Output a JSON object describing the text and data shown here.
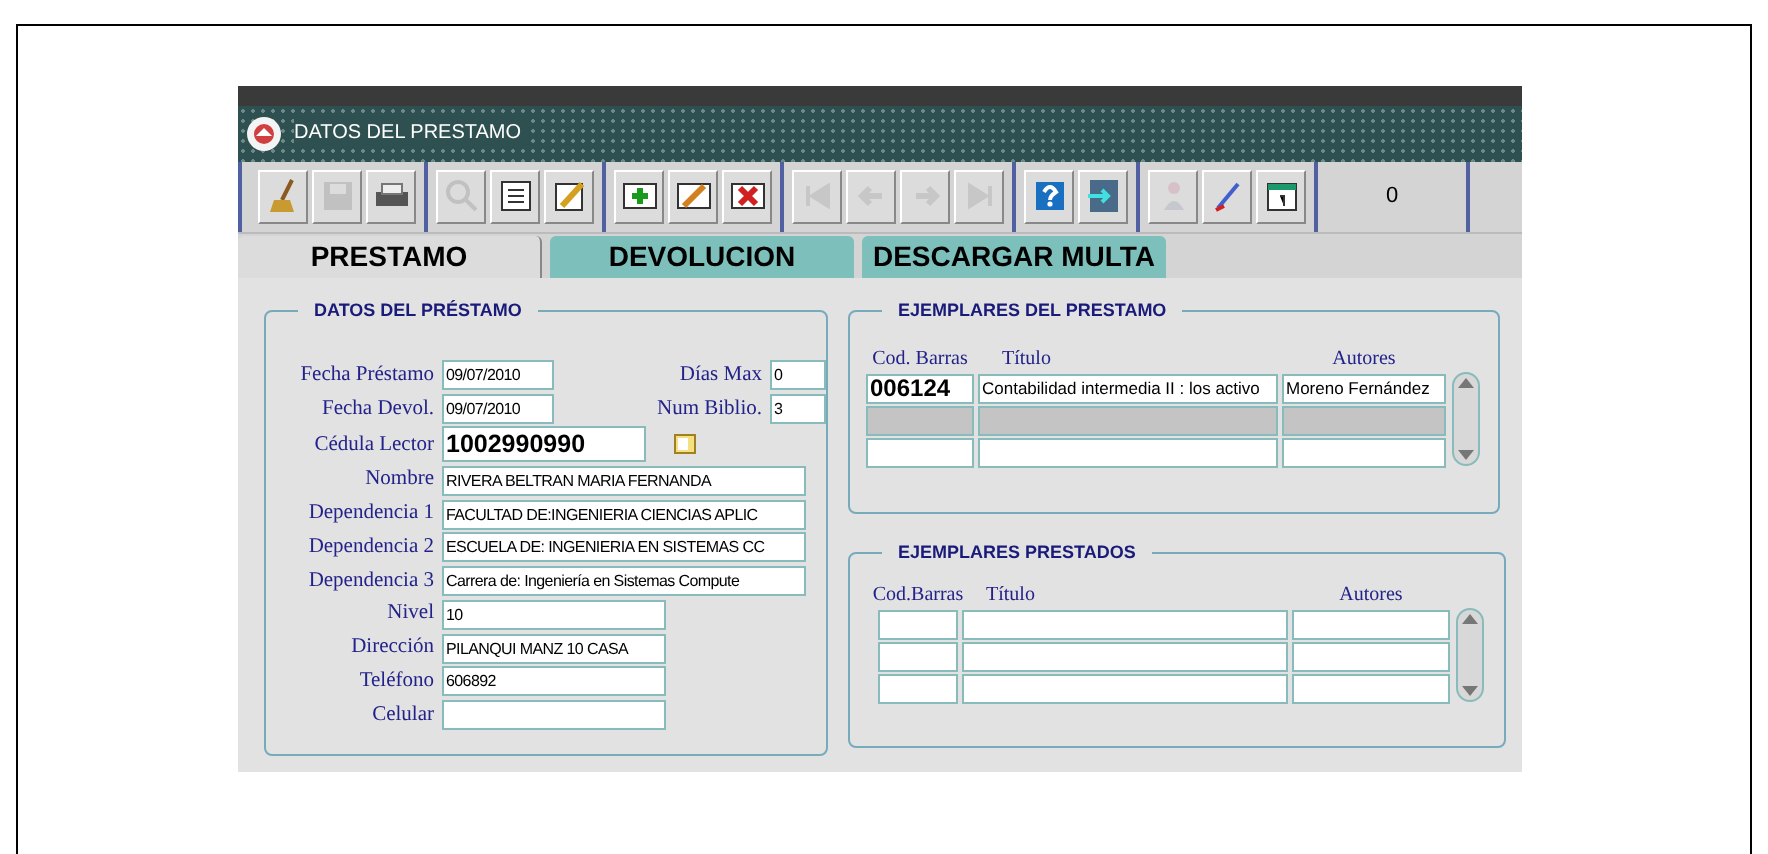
{
  "window": {
    "title": "DATOS DEL PRESTAMO"
  },
  "toolbar": {
    "groups": [
      {
        "buttons": [
          {
            "kind": "broom",
            "disabled": false
          },
          {
            "kind": "save",
            "disabled": true
          },
          {
            "kind": "printer",
            "disabled": false
          }
        ]
      },
      {
        "buttons": [
          {
            "kind": "search",
            "disabled": true
          },
          {
            "kind": "list",
            "disabled": false
          },
          {
            "kind": "pencil",
            "disabled": false
          }
        ]
      },
      {
        "buttons": [
          {
            "kind": "add",
            "disabled": false
          },
          {
            "kind": "edit",
            "disabled": false
          },
          {
            "kind": "delete",
            "disabled": false
          }
        ]
      },
      {
        "buttons": [
          {
            "kind": "first",
            "disabled": true
          },
          {
            "kind": "prev",
            "disabled": true
          },
          {
            "kind": "next",
            "disabled": true
          },
          {
            "kind": "last",
            "disabled": true
          }
        ]
      },
      {
        "buttons": [
          {
            "kind": "help",
            "disabled": false
          },
          {
            "kind": "exit",
            "disabled": false
          }
        ]
      },
      {
        "buttons": [
          {
            "kind": "person",
            "disabled": true
          },
          {
            "kind": "pen",
            "disabled": false
          },
          {
            "kind": "calendar",
            "disabled": false
          }
        ]
      }
    ],
    "counter": "0"
  },
  "tabs": [
    {
      "label": "PRESTAMO",
      "selected": true
    },
    {
      "label": "DEVOLUCION",
      "selected": false
    },
    {
      "label": "DESCARGAR MULTA",
      "selected": false
    }
  ],
  "loan_panel": {
    "title": "DATOS DEL PRÉSTAMO",
    "rows": [
      [
        {
          "label": "Fecha Préstamo",
          "value": "09/07/2010",
          "kind": "date"
        },
        {
          "label": "Días Max",
          "value": "0",
          "kind": "tiny"
        }
      ],
      [
        {
          "label": "Fecha Devol.",
          "value": "09/07/2010",
          "kind": "date"
        },
        {
          "label": "Num Biblio.",
          "value": "3",
          "kind": "tiny"
        }
      ],
      [
        {
          "label": "Cédula Lector",
          "value": "1002990990",
          "kind": "id"
        }
      ],
      [
        {
          "label": "Nombre",
          "value": "RIVERA BELTRAN MARIA FERNANDA",
          "kind": "long"
        }
      ],
      [
        {
          "label": "Dependencia 1",
          "value": "FACULTAD DE:INGENIERIA CIENCIAS APLIC",
          "kind": "long"
        }
      ],
      [
        {
          "label": "Dependencia 2",
          "value": "ESCUELA DE: INGENIERIA EN SISTEMAS CC",
          "kind": "long"
        }
      ],
      [
        {
          "label": "Dependencia 3",
          "value": "Carrera de: Ingeniería en Sistemas Compute",
          "kind": "long"
        }
      ],
      [
        {
          "label": "Nivel",
          "value": "10",
          "kind": "medium"
        }
      ],
      [
        {
          "label": "Dirección",
          "value": "PILANQUI MANZ 10 CASA",
          "kind": "medium"
        }
      ],
      [
        {
          "label": "Teléfono",
          "value": "606892",
          "kind": "medium"
        }
      ],
      [
        {
          "label": "Celular",
          "kind": "medium"
        }
      ]
    ]
  },
  "copies_panel": {
    "title": "EJEMPLARES DEL PRESTAMO",
    "columns": [
      "Cod. Barras",
      "Título",
      "Autores"
    ],
    "rows": [
      {
        "selected": false,
        "cells": [
          "006124",
          "Contabilidad intermedia II : los activo",
          "Moreno Fernández"
        ]
      },
      {
        "selected": true,
        "cells": []
      },
      {
        "selected": false,
        "cells": []
      }
    ]
  },
  "loaned_panel": {
    "title": "EJEMPLARES PRESTADOS",
    "columns": [
      "Cod.Barras",
      "Título",
      "Autores"
    ],
    "rows": [
      {
        "selected": false,
        "cells": []
      },
      {
        "selected": false,
        "cells": []
      },
      {
        "selected": false,
        "cells": []
      }
    ]
  }
}
